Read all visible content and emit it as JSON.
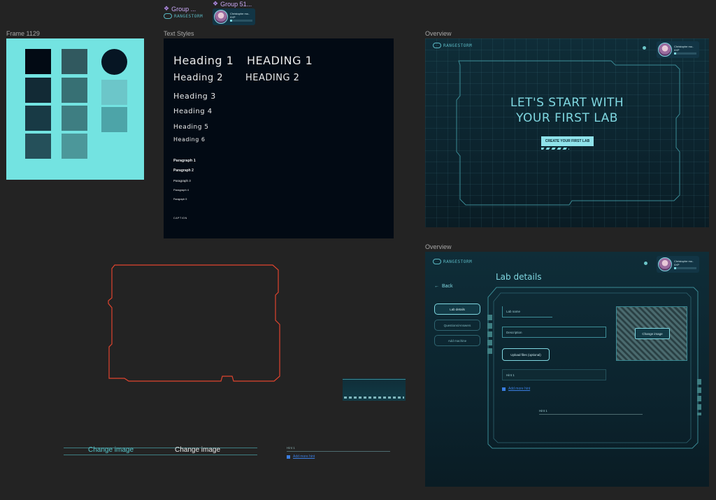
{
  "components": {
    "group_a": {
      "label": "Group ...",
      "logo": "RANGESTORM"
    },
    "group_b": {
      "label": "Group 51...",
      "profile_name": "Christophe mo..",
      "xp": "0XP"
    }
  },
  "frames": {
    "frame_1129": {
      "label": "Frame 1129"
    },
    "text_styles": {
      "label": "Text Styles"
    },
    "overview_1": {
      "label": "Overview"
    },
    "overview_2": {
      "label": "Overview"
    }
  },
  "palette": {
    "background": "#73e3e1",
    "swatches": [
      "#020a14",
      "#31595f",
      "#061523",
      "#122a35",
      "#377074",
      "#6cc6c9",
      "#183a45",
      "#3e7e82",
      "#4da4a8",
      "#25505a",
      "#4c979a"
    ]
  },
  "text_styles": {
    "headings": [
      "Heading 1",
      "Heading 2",
      "Heading 3",
      "Heading 4",
      "Heading 5",
      "Heading 6"
    ],
    "headings_caps": [
      "HEADING 1",
      "HEADING 2"
    ],
    "paragraphs": [
      "Paragraph 1",
      "Paragraph 2",
      "Paragraph 3",
      "Paragraph 4",
      "Paragraph 5"
    ],
    "caption": "CAPTION"
  },
  "overview_1": {
    "logo": "RANGESTORM",
    "profile_name": "Christophe mo..",
    "xp": "0XP",
    "title_line1": "LET'S START WITH",
    "title_line2": "YOUR FIRST LAB",
    "cta": "CREATE YOUR FIRST LAB"
  },
  "overview_2": {
    "logo": "RANGESTORM",
    "profile_name": "Christophe mo..",
    "xp": "0XP",
    "page_title": "Lab details",
    "back": "Back",
    "sidebar": [
      "Lab details",
      "Questions/Answers",
      "Add machine"
    ],
    "lab_name": "Lab name",
    "description": "Description",
    "upload": "Upload files (optional)",
    "hint1": "Hint 1",
    "add_more_hint": "Add more hint",
    "change_image": "Change image",
    "hint_bottom": "Hint 1"
  },
  "loose": {
    "change_image_a": "Change image",
    "change_image_b": "Change image",
    "hint1": "Hint 1",
    "add_more_hint": "Add more hint"
  },
  "colors": {
    "accent": "#7fd7e0",
    "frame_red": "#e0442e",
    "link": "#3a7de0"
  },
  "profile_progress": 0.1
}
